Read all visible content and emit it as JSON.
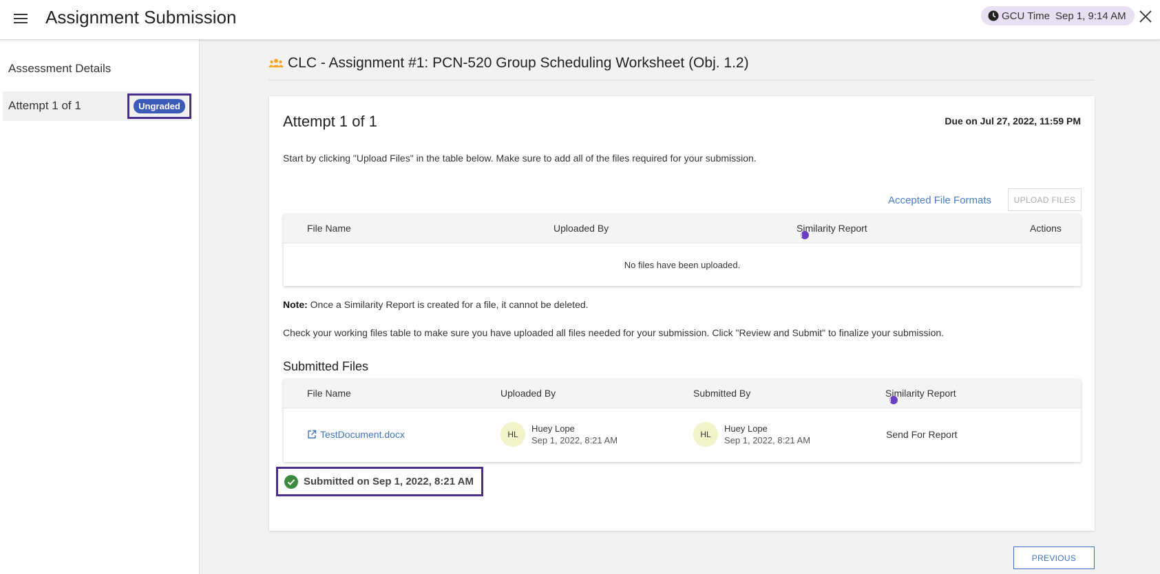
{
  "header": {
    "title": "Assignment Submission",
    "time_label": "GCU Time",
    "time_value": "Sep 1, 9:14 AM"
  },
  "sidebar": {
    "heading": "Assessment Details",
    "items": [
      {
        "label": "Attempt 1 of 1",
        "badge": "Ungraded"
      }
    ]
  },
  "main": {
    "assignment_title": "CLC - Assignment #1: PCN-520 Group Scheduling Worksheet (Obj. 1.2)",
    "attempt_title": "Attempt 1 of 1",
    "due": "Due on Jul 27, 2022, 11:59 PM",
    "instructions": "Start by clicking \"Upload Files\" in the table below. Make sure to add all of the files required for your submission.",
    "accepted_formats_link": "Accepted File Formats",
    "upload_button": "UPLOAD FILES",
    "working_table": {
      "columns": [
        "File Name",
        "Uploaded By",
        "Similarity Report",
        "Actions"
      ],
      "empty_message": "No files have been uploaded."
    },
    "note_label": "Note:",
    "note_text": " Once a Similarity Report is created for a file, it cannot be deleted.",
    "check_text": "Check your working files table to make sure you have uploaded all files needed for your submission. Click \"Review and Submit\" to finalize your submission.",
    "submitted_heading": "Submitted Files",
    "submitted_table": {
      "columns": [
        "File Name",
        "Uploaded By",
        "Submitted By",
        "Similarity Report"
      ],
      "rows": [
        {
          "file_name": "TestDocument.docx",
          "uploaded_by": {
            "initials": "HL",
            "name": "Huey Lope",
            "date": "Sep 1, 2022, 8:21 AM"
          },
          "submitted_by": {
            "initials": "HL",
            "name": "Huey Lope",
            "date": "Sep 1, 2022, 8:21 AM"
          },
          "similarity_action": "Send For Report"
        }
      ]
    },
    "submitted_status": "Submitted on Sep 1, 2022, 8:21 AM",
    "previous_button": "PREVIOUS"
  },
  "colors": {
    "accent_purple": "#4b2c8f",
    "badge_blue": "#3c5bb8",
    "link_blue": "#3f73bd",
    "success_green": "#3d8b3d",
    "group_icon_orange": "#f5a623"
  }
}
